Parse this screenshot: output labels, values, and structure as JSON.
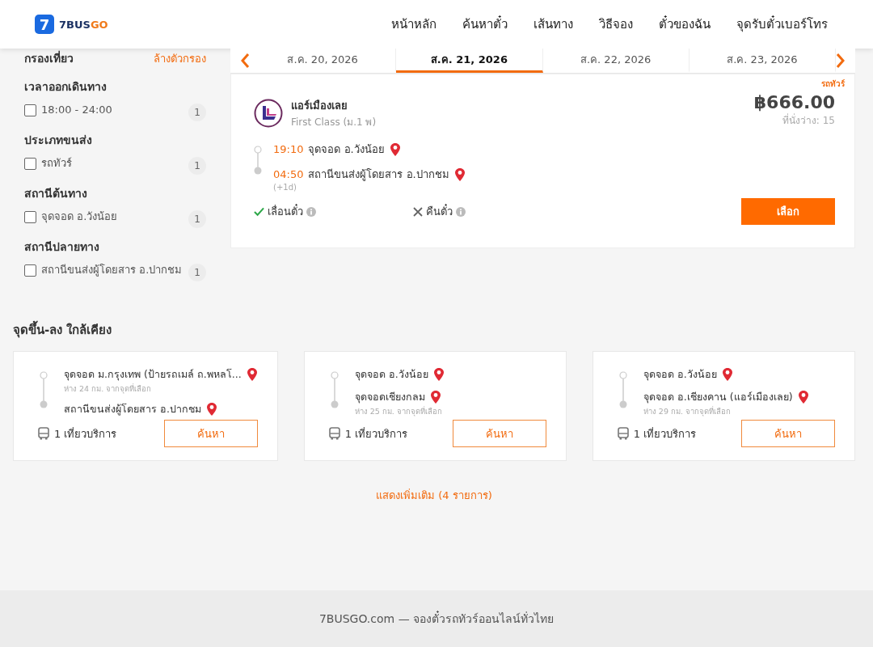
{
  "header": {
    "logo": {
      "mark": "7",
      "text": "7BUS",
      "accent": "GO"
    },
    "nav": [
      {
        "label": "หน้าหลัก"
      },
      {
        "label": "ค้นหาตั๋ว"
      },
      {
        "label": "เส้นทาง"
      },
      {
        "label": "วิธีจอง"
      },
      {
        "label": "ตั๋วของฉัน"
      },
      {
        "label": "จุดรับตั๋วเบอร์โทร"
      }
    ]
  },
  "filters": {
    "title": "กรองเที่ยว",
    "clear": "ล้างตัวกรอง",
    "groups": [
      {
        "title": "เวลาออกเดินทาง",
        "options": [
          {
            "label": "18:00 - 24:00",
            "count": "1",
            "checked": false
          }
        ]
      },
      {
        "title": "ประเภทขนส่ง",
        "options": [
          {
            "label": "รถทัวร์",
            "count": "1",
            "checked": false
          }
        ]
      },
      {
        "title": "สถานีต้นทาง",
        "options": [
          {
            "label": "จุดจอด อ.วังน้อย",
            "count": "1",
            "checked": false
          }
        ]
      },
      {
        "title": "สถานีปลายทาง",
        "options": [
          {
            "label": "สถานีขนส่งผู้โดยสาร อ.ปากชม",
            "count": "1",
            "checked": false
          }
        ]
      }
    ]
  },
  "dates": [
    {
      "label": "ส.ค. 20, 2026",
      "selected": false
    },
    {
      "label": "ส.ค. 21, 2026",
      "selected": true
    },
    {
      "label": "ส.ค. 22, 2026",
      "selected": false
    },
    {
      "label": "ส.ค. 23, 2026",
      "selected": false
    }
  ],
  "trip": {
    "operator": "แอร์เมืองเลย",
    "class": "First Class (ม.1 พ)",
    "type": "รถทัวร์",
    "price": "฿666.00",
    "seats": "ที่นั่งว่าง: 15",
    "departure": {
      "time": "19:10",
      "stop": "จุดจอด อ.วังน้อย"
    },
    "arrival": {
      "time": "04:50",
      "stop": "สถานีขนส่งผู้โดยสาร อ.ปากชม",
      "day_offset": "(+1d)"
    },
    "features": [
      {
        "label": "เลื่อนตั๋ว",
        "allowed": true
      },
      {
        "label": "คืนตั๋ว",
        "allowed": false
      }
    ],
    "button": "เลือก"
  },
  "nearby": {
    "title": "จุดขึ้น-ลง ใกล้เคียง",
    "cards": [
      {
        "from": "จุดจอด ม.กรุงเทพ (ป้ายรถเมล์ ถ.พหลโ...",
        "from_distance": "ห่าง 24 กม. จากจุดที่เลือก",
        "to": "สถานีขนส่งผู้โดยสาร อ.ปากชม",
        "trips": "1 เที่ยวบริการ",
        "button": "ค้นหา"
      },
      {
        "from": "จุดจอด อ.วังน้อย",
        "to": "จุดจอดเชียงกลม",
        "to_distance": "ห่าง 25 กม. จากจุดที่เลือก",
        "trips": "1 เที่ยวบริการ",
        "button": "ค้นหา"
      },
      {
        "from": "จุดจอด อ.วังน้อย",
        "to": "จุดจอด อ.เชียงคาน (แอร์เมืองเลย)",
        "to_distance": "ห่าง 29 กม. จากจุดที่เลือก",
        "trips": "1 เที่ยวบริการ",
        "button": "ค้นหา"
      }
    ],
    "more": "แสดงเพิ่มเติม (4 รายการ)"
  },
  "footer": "7BUSGO.com — จองตั๋วรถทัวร์ออนไลน์ทั่วไทย"
}
